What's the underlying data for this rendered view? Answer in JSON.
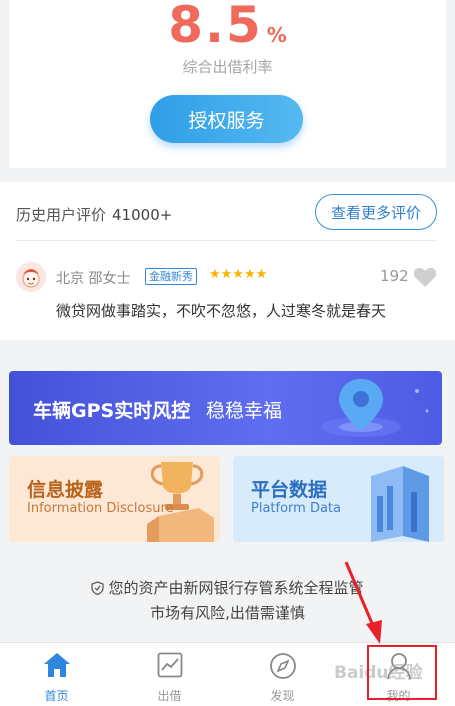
{
  "rate": {
    "value": "8.5",
    "unit": "%",
    "label": "综合出借利率"
  },
  "auth_button": "授权服务",
  "reviews": {
    "title": "历史用户评价",
    "count": "41000+",
    "more_button": "查看更多评价",
    "item": {
      "name": "北京 邵女士",
      "badge": "金融新秀",
      "stars": "★★★★★",
      "likes": "192",
      "text": "微贷网做事踏实，不吹不忽悠，人过寒冬就是春天"
    }
  },
  "promo": {
    "title": "车辆GPS实时风控",
    "subtitle": "稳稳幸福"
  },
  "tiles": [
    {
      "title": "信息披露",
      "subtitle": "Information Disclosure"
    },
    {
      "title": "平台数据",
      "subtitle": "Platform Data"
    }
  ],
  "notice": {
    "line1": "您的资产由新网银行存管系统全程监管",
    "line2": "市场有风险,出借需谨慎"
  },
  "tabbar": [
    {
      "label": "首页",
      "icon": "home-icon",
      "active": true
    },
    {
      "label": "出借",
      "icon": "chart-icon",
      "active": false
    },
    {
      "label": "发现",
      "icon": "compass-icon",
      "active": false
    },
    {
      "label": "我的",
      "icon": "user-icon",
      "active": false
    }
  ],
  "watermark": "Baidu经验",
  "colors": {
    "accent": "#2e86de",
    "rate": "#ef6a5a",
    "annotation": "#e8202a"
  }
}
